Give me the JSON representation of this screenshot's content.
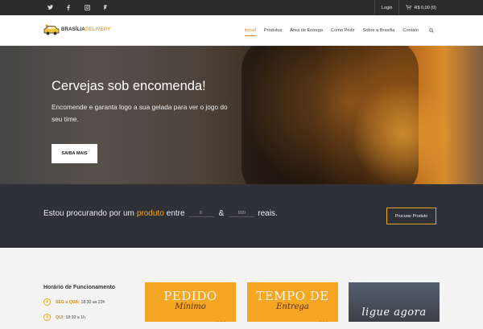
{
  "topbar": {
    "social_icons": [
      "twitter-icon",
      "facebook-icon",
      "instagram-icon",
      "foursquare-icon"
    ],
    "login_label": "Login",
    "cart_label": "R$ 0,00 (0)"
  },
  "navbar": {
    "logo_main": "BRASÍLIA",
    "logo_accent": "DELIVERY",
    "menu": [
      "Inicial",
      "Produtos",
      "Área de Entrega",
      "Como Pedir",
      "Sobre a Brasília",
      "Contato"
    ]
  },
  "hero": {
    "title": "Cervejas sob encomenda!",
    "subtitle": "Encomende e garanta logo a sua gelada para ver o jogo do seu time.",
    "button": "SAIBA MAIS"
  },
  "search": {
    "text_before": "Estou procurando por um",
    "highlight": "produto",
    "text_between": "entre",
    "min_value": "0",
    "amp": "&",
    "max_value": "900",
    "text_after": "reais.",
    "button": "Procurar Produto"
  },
  "hours": {
    "title": "Horário de Funcionamento",
    "rows": [
      {
        "day": "SEG a QUA:",
        "time": "18:30 as 23h"
      },
      {
        "day": "QUI:",
        "time": "18:30 a 1h"
      }
    ]
  },
  "cards": [
    {
      "line1": "PEDIDO",
      "line2": "Mínimo",
      "line3": "..."
    },
    {
      "line1": "TEMPO DE",
      "line2": "Entrega",
      "line3": "..."
    },
    {
      "line1": "ligue agora"
    }
  ],
  "colors": {
    "accent": "#f5a623",
    "dark_band": "#2f3038",
    "topbar": "#2c2c2c"
  }
}
